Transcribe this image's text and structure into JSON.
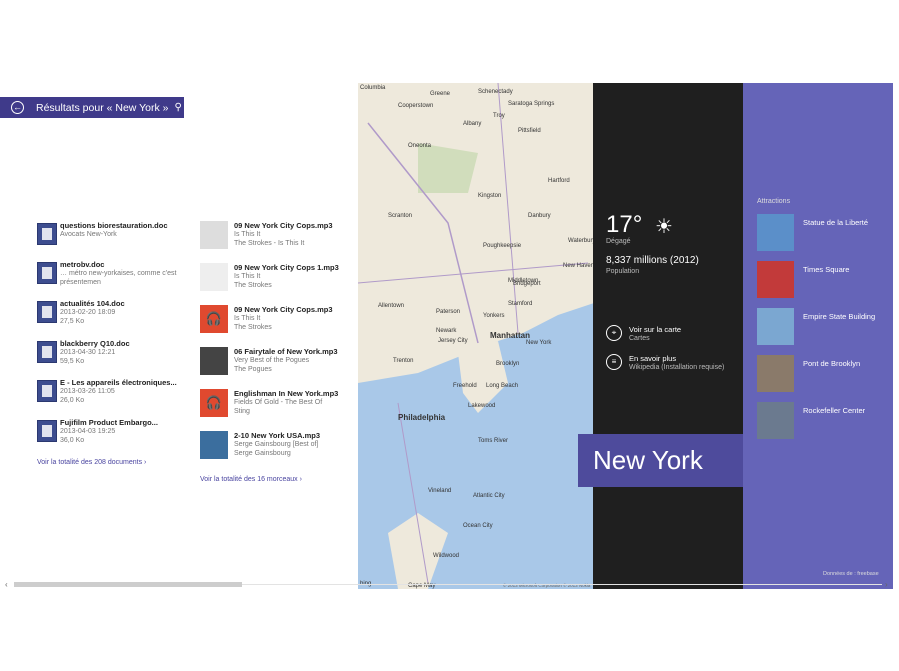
{
  "header": {
    "search_title": "Résultats pour « New York »"
  },
  "documents": [
    {
      "title": "questions biorestauration.doc",
      "line1": "Avocats New-York",
      "line2": ""
    },
    {
      "title": "metrobv.doc",
      "line1": "… métro new-yorkaises, comme c'est",
      "line2": "présentemen"
    },
    {
      "title": "actualités 104.doc",
      "line1": "2013-02-20 18:09",
      "line2": "27,5 Ko"
    },
    {
      "title": "blackberry Q10.doc",
      "line1": "2013-04-30 12:21",
      "line2": "59,5 Ko"
    },
    {
      "title": "E - Les appareils électroniques...",
      "line1": "2013-03-26 11:05",
      "line2": "26,0 Ko"
    },
    {
      "title": "Fujifilm Product Embargo...",
      "line1": "2013-04-03 19:25",
      "line2": "36,0 Ko"
    }
  ],
  "documents_link": "Voir la totalité des 208 documents ›",
  "songs": [
    {
      "title": "09 New York City Cops.mp3",
      "line1": "Is This It",
      "line2": "The Strokes - Is This It",
      "thumb": "sketch"
    },
    {
      "title": "09 New York City Cops 1.mp3",
      "line1": "Is This It",
      "line2": "The Strokes",
      "thumb": "blank"
    },
    {
      "title": "09 New York City Cops.mp3",
      "line1": "Is This It",
      "line2": "The Strokes",
      "thumb": "orange"
    },
    {
      "title": "06 Fairytale of New York.mp3",
      "line1": "Very Best of the Pogues",
      "line2": "The Pogues",
      "thumb": "bw"
    },
    {
      "title": "Englishman In New York.mp3",
      "line1": "Fields Of Gold - The Best Of",
      "line2": "Sting",
      "thumb": "orange"
    },
    {
      "title": "2-10 New York USA.mp3",
      "line1": "Serge Gainsbourg [Best of]",
      "line2": "Serge Gainsbourg",
      "thumb": "blue"
    }
  ],
  "songs_link": "Voir la totalité des 16 morceaux ›",
  "map": {
    "labels": [
      "Columbia",
      "Greene",
      "Schenectady",
      "Saratoga Springs",
      "Cooperstown",
      "Albany",
      "Troy",
      "Pittsfield",
      "Oneonta",
      "Kingston",
      "Poughkeepsie",
      "Danbury",
      "Waterbury",
      "Hartford",
      "Middletown",
      "New Haven",
      "Bridgeport",
      "Stamford",
      "Yonkers",
      "Paterson",
      "Newark",
      "Jersey City",
      "Manhattan",
      "New York",
      "Brooklyn",
      "Long Beach",
      "Trenton",
      "Philadelphia",
      "Allentown",
      "Scranton",
      "Toms River",
      "Atlantic City",
      "Vineland",
      "Ocean City",
      "Cape May",
      "Lakewood",
      "Freehold",
      "Wildwood"
    ],
    "copyright": "© 2013 Microsoft Corporation © 2013 Nokia",
    "bing": "bing"
  },
  "weather": {
    "temp": "17°",
    "condition": "Dégagé",
    "population_value": "8,337 millions (2012)",
    "population_label": "Population"
  },
  "actions": [
    {
      "title": "Voir sur la carte",
      "sub": "Cartes"
    },
    {
      "title": "En savoir plus",
      "sub": "Wikipedia (Installation requise)"
    }
  ],
  "city_title": "New York",
  "attractions_header": "Attractions",
  "attractions": [
    {
      "label": "Statue de la Liberté",
      "color": "#5b8fc9"
    },
    {
      "label": "Times Square",
      "color": "#c23a3a"
    },
    {
      "label": "Empire State Building",
      "color": "#7ba7d1"
    },
    {
      "label": "Pont de Brooklyn",
      "color": "#8a7a6a"
    },
    {
      "label": "Rockefeller Center",
      "color": "#6b7a8f"
    }
  ],
  "freebase_credit": "Données de : freebase",
  "colors": {
    "accent": "#4e4b9c",
    "purple_panel": "#6564b8",
    "dark_panel": "#1f1f1f",
    "water": "#a9c8e8"
  }
}
